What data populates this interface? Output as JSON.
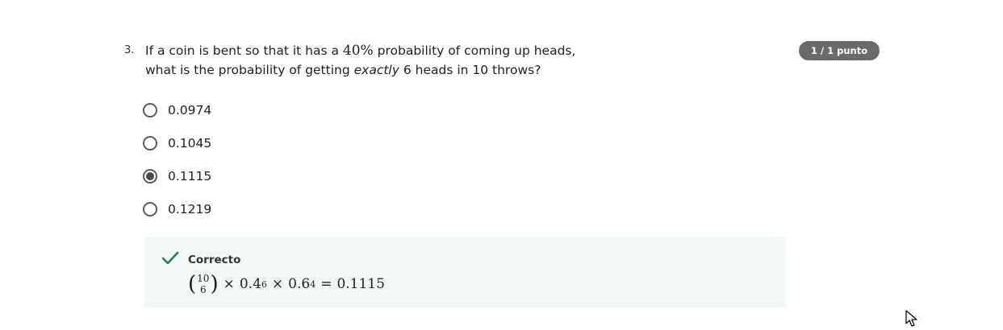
{
  "question": {
    "number": "3.",
    "text_before": "If a coin is bent so that it has a ",
    "percent": "40%",
    "text_mid": " probability of coming up heads, what is the probability of getting ",
    "emphasis": "exactly",
    "text_after": " 6 heads in 10 throws?"
  },
  "score": "1 / 1 punto",
  "options": [
    {
      "label": "0.0974",
      "selected": false
    },
    {
      "label": "0.1045",
      "selected": false
    },
    {
      "label": "0.1115",
      "selected": true
    },
    {
      "label": "0.1219",
      "selected": false
    }
  ],
  "feedback": {
    "status": "Correcto",
    "status_color": "#1f8354",
    "formula": {
      "binom_top": "10",
      "binom_bottom": "6",
      "times1": "×",
      "base1": "0.4",
      "exp1": "6",
      "times2": "×",
      "base2": "0.6",
      "exp2": "4",
      "equals": "=",
      "result": "0.1115"
    }
  },
  "icons": {
    "feedback": "check-icon",
    "pointer": "mouse-cursor-icon"
  }
}
